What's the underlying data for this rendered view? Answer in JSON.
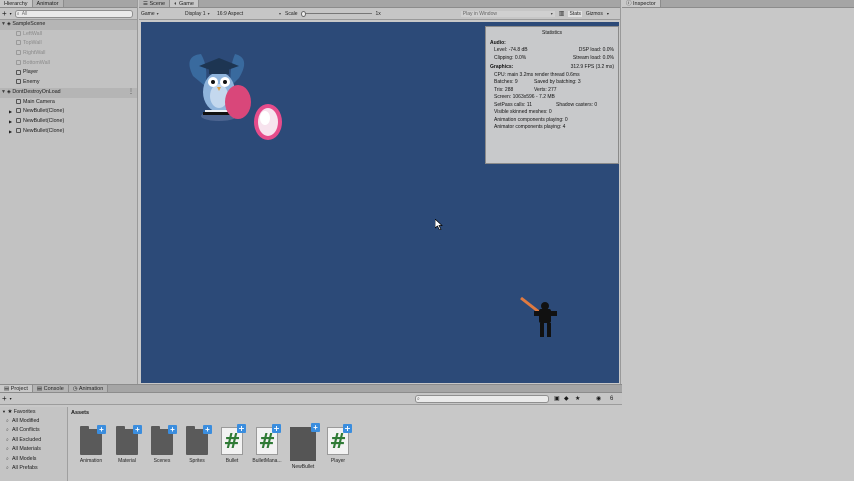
{
  "hierarchy": {
    "tabs": [
      "Hierarchy",
      "Animator"
    ],
    "search_placeholder": "All",
    "add_label": "+",
    "rows": [
      {
        "label": "SampleScene",
        "type": "scene"
      },
      {
        "label": "LeftWall",
        "type": "child-dim"
      },
      {
        "label": "TopWall",
        "type": "child-dim"
      },
      {
        "label": "RightWall",
        "type": "child-dim"
      },
      {
        "label": "BottomWall",
        "type": "child-dim"
      },
      {
        "label": "Player",
        "type": "child"
      },
      {
        "label": "Enemy",
        "type": "child"
      },
      {
        "label": "DontDestroyOnLoad",
        "type": "scene"
      },
      {
        "label": "Main Camera",
        "type": "child"
      },
      {
        "label": "NewBullet(Clone)",
        "type": "child-exp"
      },
      {
        "label": "NewBullet(Clone)",
        "type": "child-exp"
      },
      {
        "label": "NewBullet(Clone)",
        "type": "child-exp"
      }
    ]
  },
  "game": {
    "tabs": [
      "Scene",
      "Game"
    ],
    "toolbar": {
      "mode": "Game",
      "display": "Display 1",
      "aspect": "16:9 Aspect",
      "scale_label": "Scale",
      "scale_value": "1x",
      "play_mode": "Play in Window",
      "stats": "Stats",
      "gizmos": "Gizmos"
    },
    "stats": {
      "title": "Statistics",
      "audio_header": "Audio:",
      "level": "Level: -74.8 dB",
      "dsp": "DSP load: 0.0%",
      "clipping": "Clipping: 0.0%",
      "stream": "Stream load: 0.0%",
      "graphics_header": "Graphics:",
      "fps": "312.9 FPS (3.2 ms)",
      "cpu": "CPU: main 3.2ms  render thread 0.6ms",
      "batches": "Batches: 9",
      "saved": "Saved by batching: 3",
      "tris": "Tris: 288",
      "verts": "Verts: 277",
      "screen": "Screen: 1063x596 - 7.2 MB",
      "setpass": "SetPass calls: 11",
      "shadow": "Shadow casters: 0",
      "skinned": "Visible skinned meshes: 0",
      "anim_comp": "Animation components playing: 0",
      "animator_comp": "Animator components playing: 4"
    }
  },
  "inspector": {
    "tab": "Inspector"
  },
  "project": {
    "tabs": [
      "Project",
      "Console",
      "Animation"
    ],
    "add_label": "+",
    "favorites_label": "Favorites",
    "favorites": [
      "All Modified",
      "All Conflicts",
      "All Excluded",
      "All Materials",
      "All Models",
      "All Prefabs"
    ],
    "breadcrumb": "Assets",
    "count": "6",
    "assets": [
      {
        "label": "Animation",
        "kind": "folder"
      },
      {
        "label": "Material",
        "kind": "folder"
      },
      {
        "label": "Scenes",
        "kind": "folder"
      },
      {
        "label": "Sprites",
        "kind": "folder"
      },
      {
        "label": "Bullet",
        "kind": "script"
      },
      {
        "label": "BulletMana...",
        "kind": "script"
      },
      {
        "label": "NewBullet",
        "kind": "prefab"
      },
      {
        "label": "Player",
        "kind": "script"
      }
    ]
  },
  "colors": {
    "game_bg": "#2c4a78",
    "enemy_ball": "#d9477a",
    "bullet": "#f0a8c8",
    "editor_bg": "#c8c8c8"
  }
}
